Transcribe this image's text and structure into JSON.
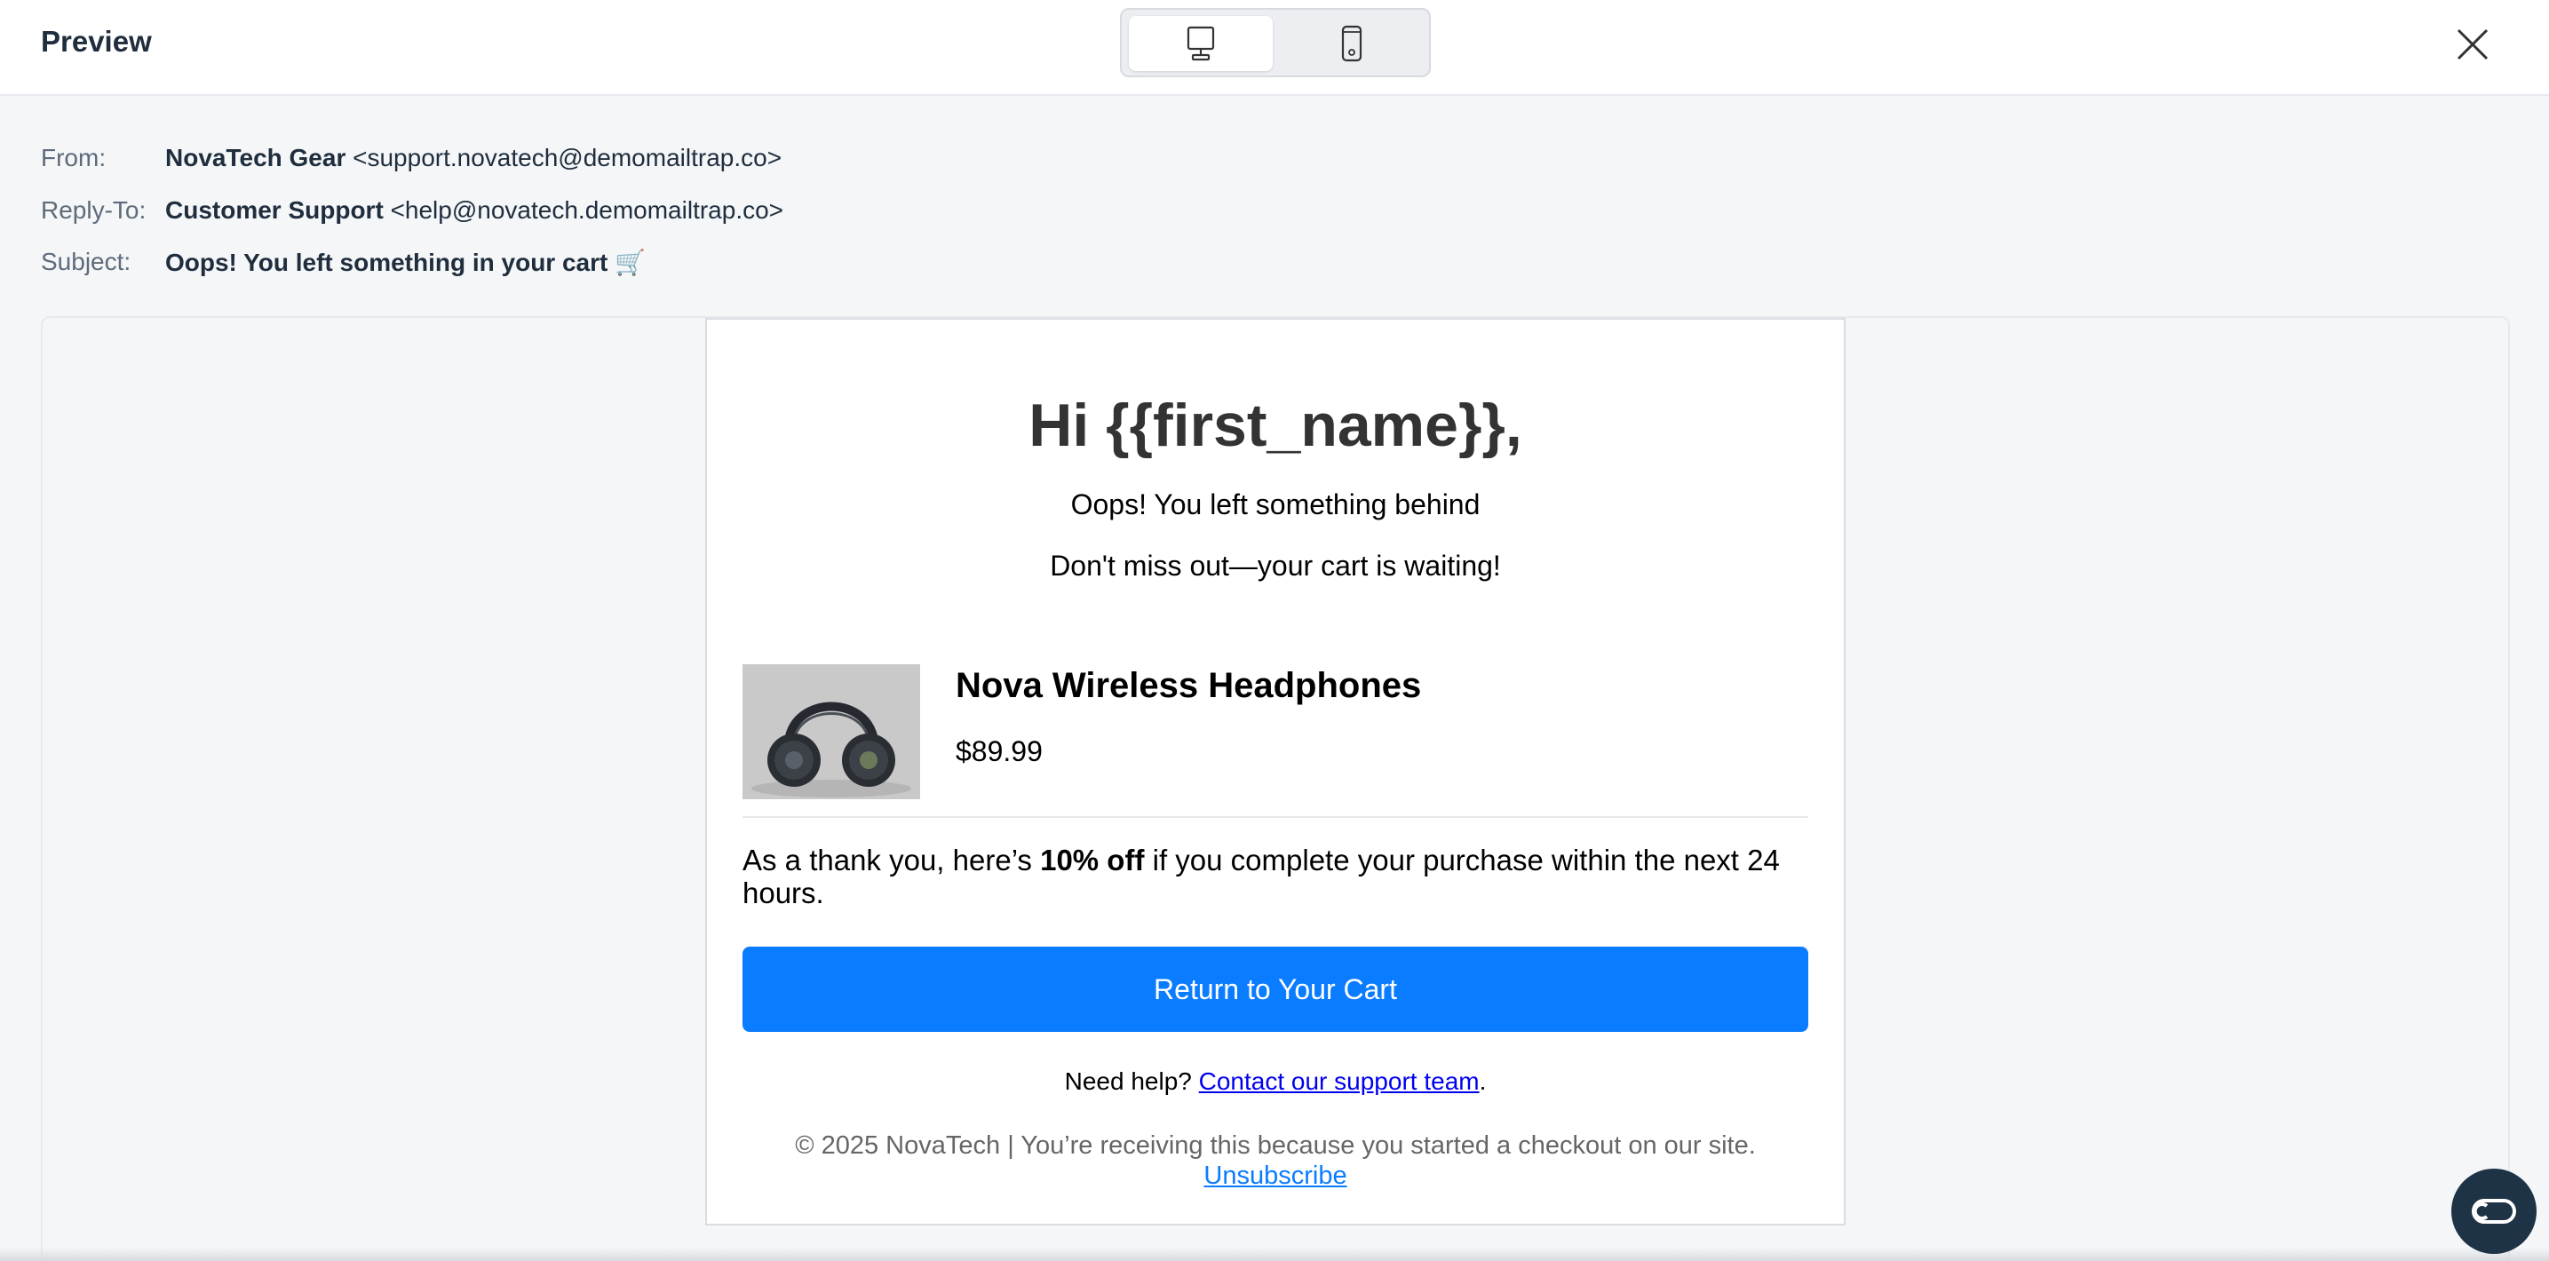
{
  "topbar": {
    "title": "Preview",
    "device_options": [
      "desktop",
      "mobile"
    ],
    "selected_device": "desktop",
    "icons": {
      "desktop": "desktop-icon",
      "mobile": "mobile-icon",
      "close": "close-icon"
    }
  },
  "meta": {
    "from_label": "From:",
    "from_name": "NovaTech Gear",
    "from_email": "<support.novatech@demomailtrap.co>",
    "reply_label": "Reply-To:",
    "reply_name": "Customer Support",
    "reply_email": "<help@novatech.demomailtrap.co>",
    "subject_label": "Subject:",
    "subject": "Oops! You left something in your cart 🛒"
  },
  "email": {
    "greeting": "Hi {{first_name}},",
    "subline1": "Oops! You left something behind",
    "subline2": "Don't miss out—your cart is waiting!",
    "product": {
      "name": "Nova Wireless Headphones",
      "price": "$89.99",
      "image": "headphones-image"
    },
    "offer_prefix": "As a thank you, here’s ",
    "offer_bold": "10% off",
    "offer_suffix": " if you complete your purchase within the next 24 hours.",
    "cta_label": "Return to Your Cart",
    "help_prefix": "Need help? ",
    "help_link": "Contact our support team",
    "help_suffix": ".",
    "footer_copy": "© 2025 NovaTech | You’re receiving this because you started a checkout on our site.",
    "unsubscribe": "Unsubscribe",
    "button_color": "#0a7cff"
  },
  "widgets": {
    "chat": "chat-icon"
  }
}
